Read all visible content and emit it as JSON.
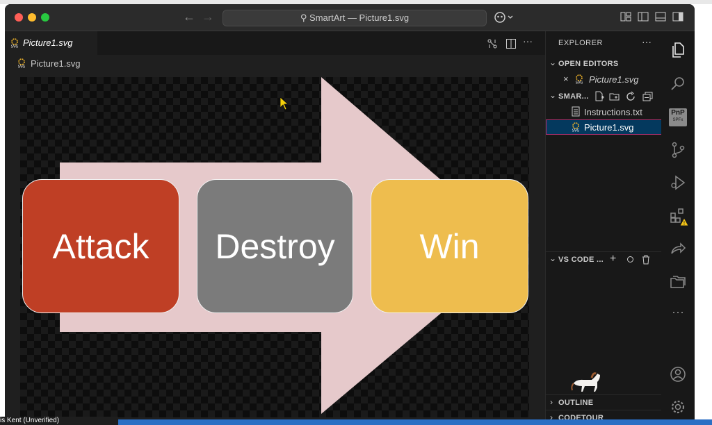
{
  "window": {
    "title": "SmartArt — Picture1.svg"
  },
  "editor": {
    "tab_label": "Picture1.svg",
    "breadcrumb": "Picture1.svg",
    "diagram": {
      "steps": [
        {
          "label": "Attack",
          "color": "#bf3f25"
        },
        {
          "label": "Destroy",
          "color": "#7b7b7b"
        },
        {
          "label": "Win",
          "color": "#eebd4e"
        }
      ],
      "arrow_color": "#e6c9cb"
    }
  },
  "sidebar": {
    "title": "EXPLORER",
    "more": "···",
    "open_editors": {
      "header": "OPEN EDITORS",
      "items": [
        {
          "name": "Picture1.svg"
        }
      ]
    },
    "folder": {
      "header": "SMAR...",
      "files": [
        {
          "name": "Instructions.txt"
        },
        {
          "name": "Picture1.svg"
        }
      ]
    },
    "vscode_panel": {
      "header": "VS CODE ..."
    },
    "outline": {
      "header": "OUTLINE"
    },
    "codetour": {
      "header": "CODETOUR"
    }
  },
  "activity": {
    "pnp_line1": "PnP",
    "pnp_line2": "SPFx",
    "more": "···"
  },
  "status": {
    "user": "is Kent (Unverified)"
  },
  "colors": {
    "accent": "#2b6fc4",
    "selection_border": "#b0306f"
  }
}
